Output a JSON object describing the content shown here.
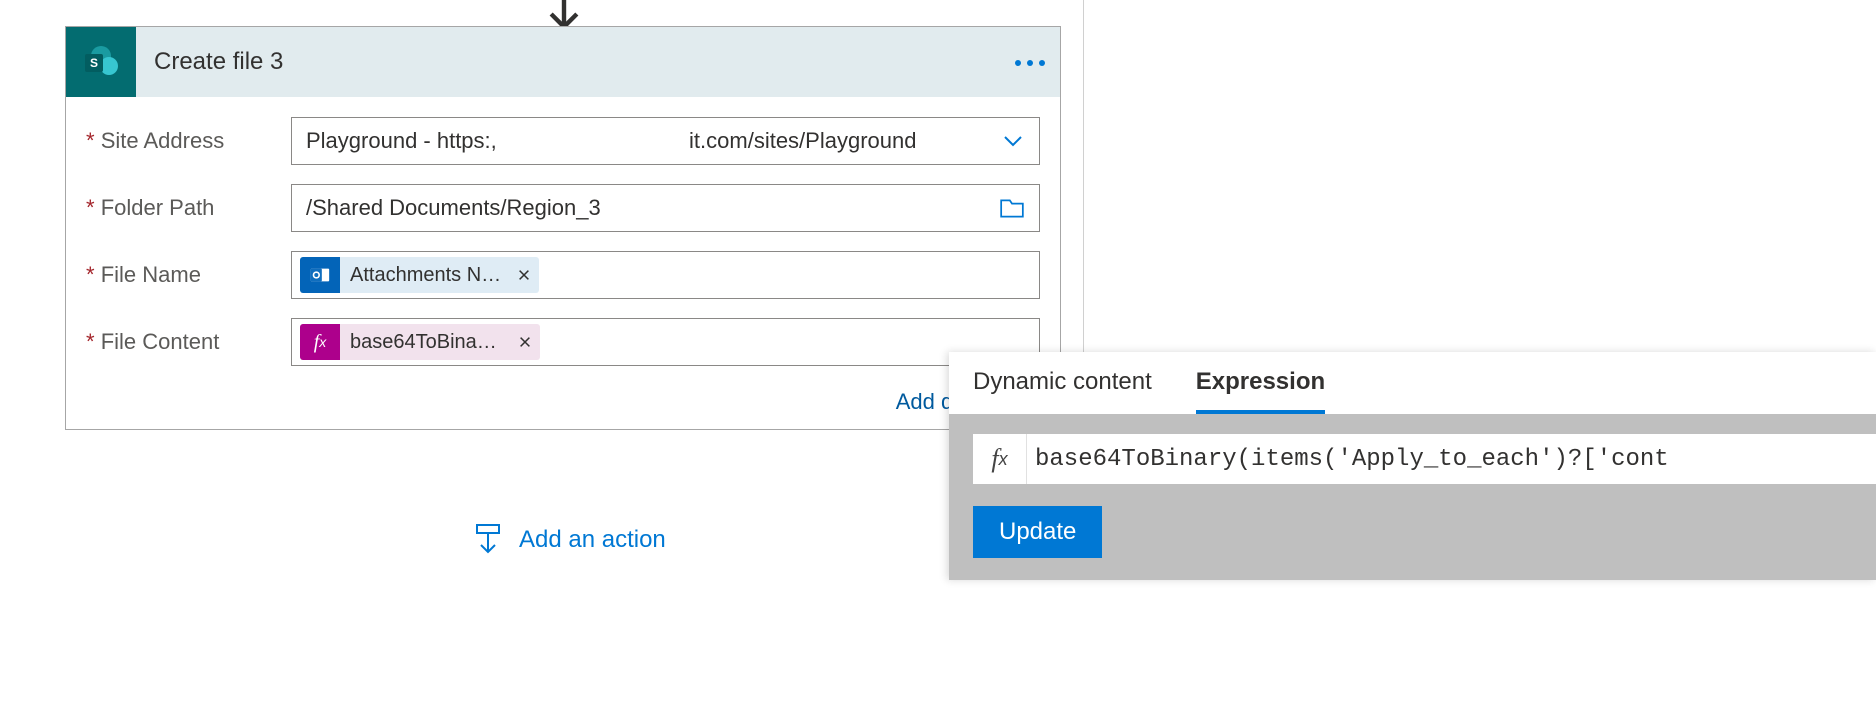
{
  "card": {
    "title": "Create file 3",
    "fields": {
      "site_address": {
        "label": "Site Address",
        "value_left": "Playground - https:,",
        "value_right": "it.com/sites/Playground"
      },
      "folder_path": {
        "label": "Folder Path",
        "value": "/Shared Documents/Region_3"
      },
      "file_name": {
        "label": "File Name",
        "token_label": "Attachments N…"
      },
      "file_content": {
        "label": "File Content",
        "token_label": "base64ToBinar…"
      }
    },
    "add_dynamic_label": "Add dynamic c"
  },
  "add_action_label": "Add an action",
  "flyout": {
    "tabs": {
      "dynamic": "Dynamic content",
      "expression": "Expression"
    },
    "fx_symbol": "fx",
    "expression_value": "base64ToBinary(items('Apply_to_each')?['cont",
    "update_label": "Update"
  }
}
